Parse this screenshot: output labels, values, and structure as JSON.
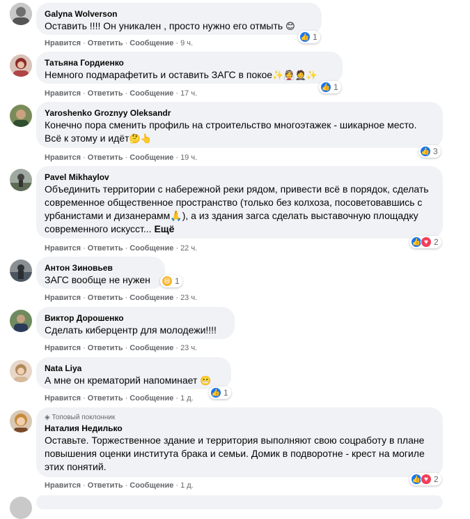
{
  "actions": {
    "like": "Нравится",
    "reply": "Ответить",
    "message": "Сообщение",
    "sep": "·"
  },
  "comments": [
    {
      "author": "Galyna Wolverson",
      "text": "Оставить !!!! Он уникален , просто нужно его отмыть",
      "emoji": "😊",
      "time": "9 ч.",
      "reactions": {
        "icons": [
          "like"
        ],
        "count": "1"
      }
    },
    {
      "author": "Татьяна Гордиенко",
      "text": "Немного подмарафетить и оставить ЗАГС в покое",
      "emoji": "✨👰🤵✨",
      "time": "17 ч.",
      "reactions": {
        "icons": [
          "like"
        ],
        "count": "1"
      }
    },
    {
      "author": "Yaroshenko Groznyy Oleksandr",
      "text": "Конечно пора сменить профиль на строительство многоэтажек - шикарное место. Всё к этому и идёт",
      "emoji": "🤔👆",
      "time": "19 ч.",
      "reactions": {
        "icons": [
          "like"
        ],
        "count": "3"
      }
    },
    {
      "author": "Pavel Mikhaylov",
      "text": "Объединить территории с набережной реки рядом, привести всё в порядок, сделать современное общественное пространство (только без колхоза, посоветовавшись с урбанистами и дизанерамм🙏), а из здания загса сделать выставочную площадку современного искусст...",
      "more": "Ещё",
      "time": "22 ч.",
      "reactions": {
        "icons": [
          "like",
          "love"
        ],
        "count": "2"
      }
    },
    {
      "author": "Антон Зиновьев",
      "text": "ЗАГС вообще не нужен",
      "time": "23 ч.",
      "reactions": {
        "icons": [
          "haha"
        ],
        "count": "1"
      }
    },
    {
      "author": "Виктор Дорошенко",
      "text": "Сделать киберцентр для молодежи!!!!",
      "time": "23 ч."
    },
    {
      "author": "Nata Liya",
      "text": "А мне он крематорий напоминает",
      "emoji": "😬",
      "time": "1 д.",
      "reactions": {
        "icons": [
          "like"
        ],
        "count": "1"
      }
    },
    {
      "badge": "Топовый поклонник",
      "author": "Наталия Недилько",
      "text": "Оставьте. Торжественное здание и территория выполняют свою соцработу в плане повышения оценки института брака и семьи. Домик в подворотне - крест на могиле этих понятий.",
      "time": "1 д.",
      "reactions": {
        "icons": [
          "like",
          "love"
        ],
        "count": "2"
      }
    }
  ]
}
